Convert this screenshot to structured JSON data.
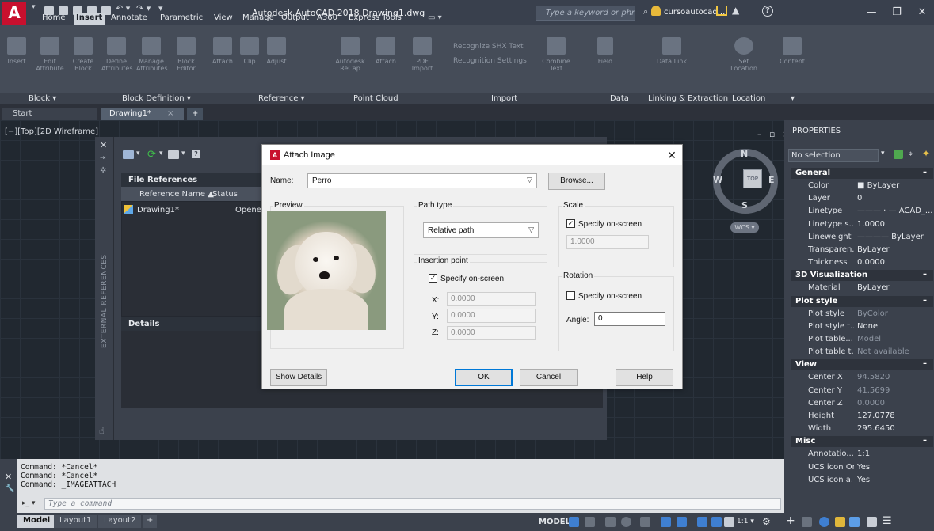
{
  "window": {
    "title": "Autodesk AutoCAD 2018   Drawing1.dwg",
    "search_placeholder": "Type a keyword or phrase",
    "user": "cursoautocad...",
    "logo": "A"
  },
  "menu_tabs": [
    "Home",
    "Insert",
    "Annotate",
    "Parametric",
    "View",
    "Manage",
    "Output",
    "A360",
    "Express Tools"
  ],
  "active_menu_tab": "Insert",
  "ribbon": {
    "buttons": [
      {
        "label": "Insert"
      },
      {
        "label": "Edit Attribute"
      },
      {
        "label": "Create Block"
      },
      {
        "label": "Define Attributes"
      },
      {
        "label": "Manage Attributes"
      },
      {
        "label": "Block Editor"
      },
      {
        "label": "Attach"
      },
      {
        "label": "Clip"
      },
      {
        "label": "Adjust"
      },
      {
        "label": "Autodesk ReCap"
      },
      {
        "label": "Attach"
      },
      {
        "label": "PDF Import"
      },
      {
        "label": "Recognize SHX Text"
      },
      {
        "label": "Recognition Settings"
      },
      {
        "label": "Combine Text"
      },
      {
        "label": "Field"
      },
      {
        "label": "Data Link"
      },
      {
        "label": "Set Location"
      },
      {
        "label": "Content"
      }
    ],
    "group_labels": [
      "Block ▾",
      "Block Definition ▾",
      "Reference ▾",
      "Point Cloud",
      "Import",
      "Data",
      "Linking & Extraction",
      "Location",
      "▾"
    ]
  },
  "doc_tabs": {
    "start": "Start",
    "drawing": "Drawing1*",
    "close": "×",
    "add": "+"
  },
  "viewport": {
    "label": "[−][Top][2D Wireframe]",
    "controls": "– ▫ ×",
    "compass": {
      "n": "N",
      "s": "S",
      "e": "E",
      "w": "W",
      "top": "TOP"
    },
    "wcs": "WCS ▾"
  },
  "xref_palette": {
    "vertical_title": "EXTERNAL REFERENCES",
    "file_references": "File References",
    "columns": [
      "Reference Name ▲",
      "Status"
    ],
    "rows": [
      {
        "name": "Drawing1*",
        "status": "Opened"
      }
    ],
    "details": "Details"
  },
  "dialog": {
    "title": "Attach Image",
    "name_label": "Name:",
    "name_value": "Perro",
    "browse": "Browse...",
    "preview_label": "Preview",
    "path_type_label": "Path type",
    "path_type_value": "Relative path",
    "scale_label": "Scale",
    "scale_specify": "Specify on-screen",
    "scale_checked": true,
    "scale_value": "1.0000",
    "insertion_label": "Insertion point",
    "insertion_specify": "Specify on-screen",
    "insertion_checked": true,
    "x_label": "X:",
    "x_value": "0.0000",
    "y_label": "Y:",
    "y_value": "0.0000",
    "z_label": "Z:",
    "z_value": "0.0000",
    "rotation_label": "Rotation",
    "rotation_specify": "Specify on-screen",
    "rotation_checked": false,
    "angle_label": "Angle:",
    "angle_value": "0",
    "show_details": "Show Details",
    "ok": "OK",
    "cancel": "Cancel",
    "help": "Help"
  },
  "command_line": {
    "history": [
      "Command: *Cancel*",
      "Command: *Cancel*",
      "Command: _IMAGEATTACH"
    ],
    "placeholder": "Type a command",
    "prompt": "▸_ ▾"
  },
  "properties": {
    "title": "PROPERTIES",
    "selection": "No selection",
    "sections": [
      {
        "name": "General",
        "rows": [
          {
            "k": "Color",
            "v": "■ ByLayer"
          },
          {
            "k": "Layer",
            "v": "0"
          },
          {
            "k": "Linetype",
            "v": "——— · — ACAD_..."
          },
          {
            "k": "Linetype s...",
            "v": "1.0000"
          },
          {
            "k": "Lineweight",
            "v": "———— ByLayer"
          },
          {
            "k": "Transparen...",
            "v": "ByLayer"
          },
          {
            "k": "Thickness",
            "v": "0.0000"
          }
        ]
      },
      {
        "name": "3D Visualization",
        "rows": [
          {
            "k": "Material",
            "v": "ByLayer"
          }
        ]
      },
      {
        "name": "Plot style",
        "rows": [
          {
            "k": "Plot style",
            "v": "ByColor",
            "dim": true
          },
          {
            "k": "Plot style t...",
            "v": "None"
          },
          {
            "k": "Plot table...",
            "v": "Model",
            "dim": true
          },
          {
            "k": "Plot table t...",
            "v": "Not available",
            "dim": true
          }
        ]
      },
      {
        "name": "View",
        "rows": [
          {
            "k": "Center X",
            "v": "94.5820",
            "dim": true
          },
          {
            "k": "Center Y",
            "v": "41.5699",
            "dim": true
          },
          {
            "k": "Center Z",
            "v": "0.0000",
            "dim": true
          },
          {
            "k": "Height",
            "v": "127.0778"
          },
          {
            "k": "Width",
            "v": "295.6450"
          }
        ]
      },
      {
        "name": "Misc",
        "rows": [
          {
            "k": "Annotatio...",
            "v": "1:1"
          },
          {
            "k": "UCS icon On",
            "v": "Yes"
          },
          {
            "k": "UCS icon a...",
            "v": "Yes"
          }
        ]
      }
    ]
  },
  "status_bar": {
    "layout_tabs": [
      "Model",
      "Layout1",
      "Layout2",
      "+"
    ],
    "model": "MODEL",
    "scale": "1:1 ▾"
  }
}
